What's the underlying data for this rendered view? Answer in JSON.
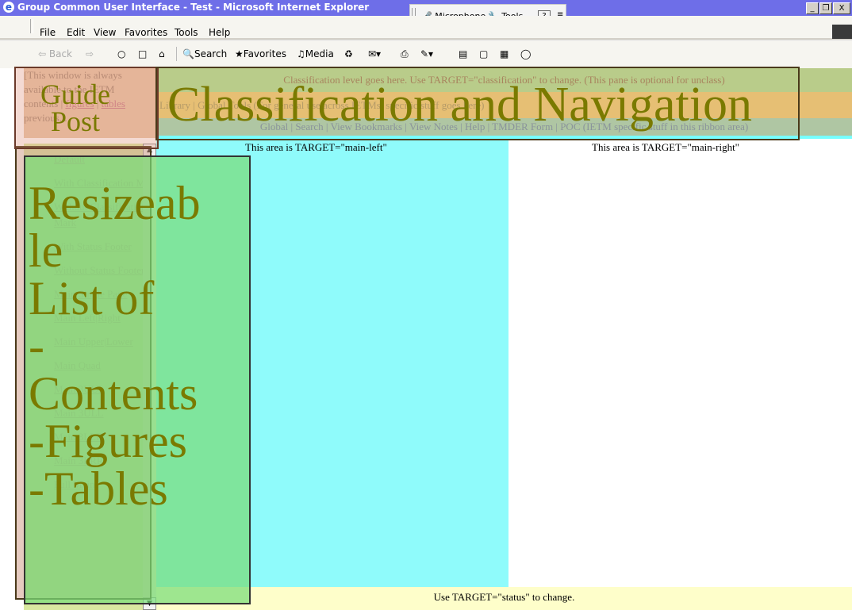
{
  "window": {
    "title": "Group Common User Interface - Test - Microsoft Internet Explorer",
    "ie_icon": "ie-logo-icon",
    "controls": [
      "_",
      "̈",
      "X"
    ]
  },
  "language_bar": {
    "microphone": "Microphone",
    "tools": "Tools",
    "help": "?",
    "more": "≡"
  },
  "menu": {
    "items": [
      "File",
      "Edit",
      "View",
      "Favorites",
      "Tools",
      "Help"
    ]
  },
  "toolbar": {
    "back": "⇦ Back",
    "forward": "⇨",
    "search": "Search",
    "favorites": "Favorites",
    "media": "Media"
  },
  "page": {
    "guide_text_1": "[This window is always",
    "guide_text_2": "available to the IETM",
    "guide_text_3": "contents |",
    "guide_link_figures": "figures",
    "guide_link_tables": "tables",
    "guide_text_4": "previous...",
    "classification": "Classification level goes here. Use TARGET=\"classification\" to change. (This pane is optional for unclass)",
    "nav": "Library | Global Tools (For general use across IETMs, specific stuff goes here)",
    "ribbon": "Global | Search | View Bookmarks | View Notes | Help | TMDER Form | POC  (IETM specific stuff in this ribbon area)",
    "main_left": "This area is TARGET=\"main-left\"",
    "main_right": "This area is TARGET=\"main-right\"",
    "status": "Use TARGET=\"status\" to change."
  },
  "sidebar": {
    "items": [
      "Default",
      "With Classification Mark",
      "Without Classification Mark",
      "With Status Footer",
      "Without Status Footer",
      "Main Single Pane",
      "Main Left|Right",
      "Main Upper|Lower",
      "Main Quad",
      "Main 3UUL",
      "Main 3ULL",
      "Main 3LLR",
      "Main 3LRR",
      "Full Main"
    ]
  },
  "annotations": {
    "guide_post": "Guide Post",
    "classification_navigation": "Classification and Navigation",
    "resizeable_list": "Resizeab\nle\nList of\n-\nContents\n-Figures\n-Tables"
  },
  "colors": {
    "titlebar": "#6e6ee8",
    "main_left_bg": "#8ffbfb",
    "status_bg": "#fefeca",
    "annotation_text": "#7a7a00"
  }
}
